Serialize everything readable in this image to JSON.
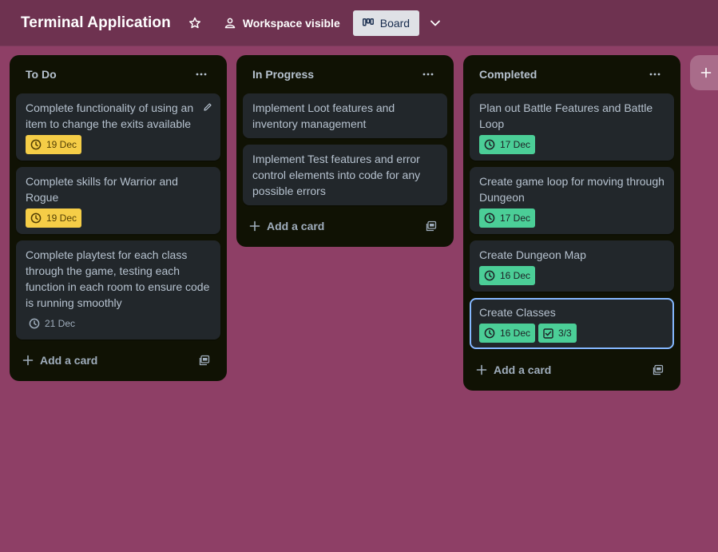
{
  "board": {
    "title": "Terminal Application",
    "visibility_label": "Workspace visible",
    "view_label": "Board"
  },
  "lists": [
    {
      "title": "To Do",
      "cards": [
        {
          "title": "Complete functionality of using an item to change the exits available",
          "due": "19 Dec"
        },
        {
          "title": "Complete skills for Warrior and Rogue",
          "due": "19 Dec"
        },
        {
          "title": "Complete playtest for each class through the game, testing each function in each room to ensure code is running smoothly",
          "due": "21 Dec"
        }
      ],
      "add_label": "Add a card"
    },
    {
      "title": "In Progress",
      "cards": [
        {
          "title": "Implement Loot features and inventory management"
        },
        {
          "title": "Implement Test features and error control elements into code for any possible errors"
        }
      ],
      "add_label": "Add a card"
    },
    {
      "title": "Completed",
      "cards": [
        {
          "title": "Plan out Battle Features and Battle Loop",
          "due": "17 Dec"
        },
        {
          "title": "Create game loop for moving through Dungeon",
          "due": "17 Dec"
        },
        {
          "title": "Create Dungeon Map",
          "due": "16 Dec"
        },
        {
          "title": "Create Classes",
          "due": "16 Dec",
          "checklist": "3/3"
        }
      ],
      "add_label": "Add a card"
    }
  ],
  "add_list_label": "+",
  "colors": {
    "background": "#8e3f66",
    "header": "#6e3250",
    "list": "#101204",
    "card": "#22272b",
    "due_soon": "#f5cd47",
    "complete": "#4bce97",
    "selected_outline": "#85b8ff"
  },
  "icons": [
    "star-icon",
    "people-icon",
    "board-icon",
    "chevron-down-icon",
    "ellipsis-icon",
    "pencil-icon",
    "clock-icon",
    "checklist-icon",
    "plus-icon",
    "template-icon"
  ]
}
